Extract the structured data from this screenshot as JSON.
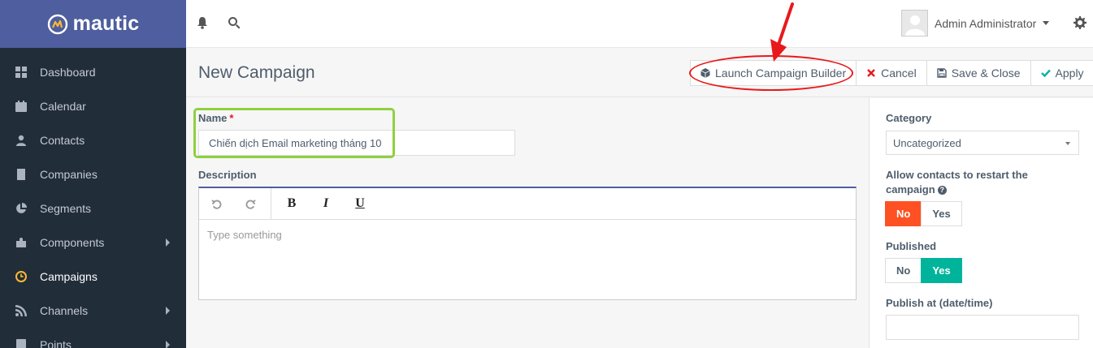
{
  "brand": {
    "name": "mautic"
  },
  "sidebar": {
    "items": [
      {
        "label": "Dashboard",
        "icon": "dashboard-icon",
        "submenu": false,
        "active": false
      },
      {
        "label": "Calendar",
        "icon": "calendar-icon",
        "submenu": false,
        "active": false
      },
      {
        "label": "Contacts",
        "icon": "user-icon",
        "submenu": false,
        "active": false
      },
      {
        "label": "Companies",
        "icon": "building-icon",
        "submenu": false,
        "active": false
      },
      {
        "label": "Segments",
        "icon": "pie-chart-icon",
        "submenu": false,
        "active": false
      },
      {
        "label": "Components",
        "icon": "puzzle-icon",
        "submenu": true,
        "active": false
      },
      {
        "label": "Campaigns",
        "icon": "clock-icon",
        "submenu": false,
        "active": true
      },
      {
        "label": "Channels",
        "icon": "rss-icon",
        "submenu": true,
        "active": false
      },
      {
        "label": "Points",
        "icon": "calculator-icon",
        "submenu": true,
        "active": false
      }
    ]
  },
  "topbar": {
    "user_name": "Admin Administrator"
  },
  "header": {
    "title": "New Campaign",
    "buttons": {
      "launch": "Launch Campaign Builder",
      "cancel": "Cancel",
      "save_close": "Save & Close",
      "apply": "Apply"
    }
  },
  "form": {
    "name_label": "Name",
    "required_mark": "*",
    "name_value": "Chiến dịch Email marketing tháng 10",
    "description_label": "Description",
    "description_placeholder": "Type something",
    "toolbar": {
      "bold": "B",
      "italic": "I",
      "underline": "U"
    }
  },
  "panel": {
    "category_label": "Category",
    "category_value": "Uncategorized",
    "restart_label": "Allow contacts to restart the campaign",
    "restart_no": "No",
    "restart_yes": "Yes",
    "published_label": "Published",
    "published_no": "No",
    "published_yes": "Yes",
    "publish_at_label": "Publish at (date/time)"
  },
  "colors": {
    "sidebar_bg": "#222d3a",
    "brand_bg": "#4e5e9e",
    "active_icon": "#fdb933",
    "toggle_no_active": "#fd5124",
    "toggle_yes_active": "#00b49c",
    "annotation_red": "#e8191b",
    "annotation_green": "#8fd13f"
  }
}
